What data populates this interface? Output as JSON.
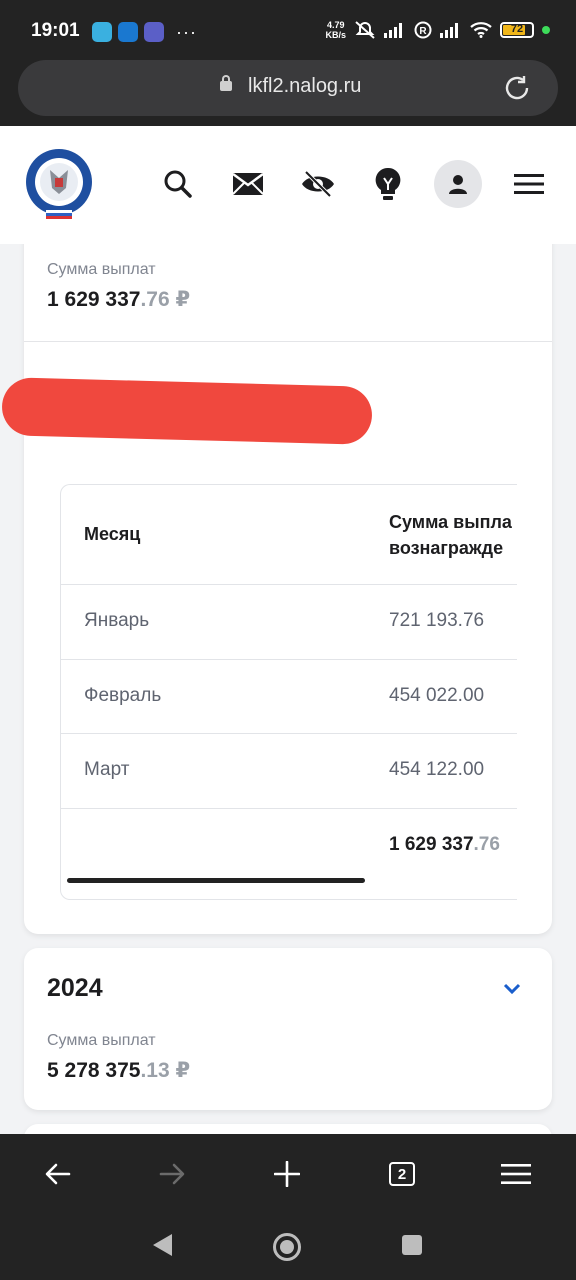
{
  "status_bar": {
    "time": "19:01",
    "more": "···",
    "speed_value": "4.79",
    "speed_unit": "KB/s",
    "battery": "72"
  },
  "browser": {
    "url": "lkfl2.nalog.ru",
    "tabs_count": "2"
  },
  "summary_top": {
    "label": "Сумма выплат",
    "amount_main": "1 629 337",
    "amount_kopecks": ".76 ₽"
  },
  "table": {
    "headers": [
      "Месяц",
      "Сумма выпла",
      "вознагражде"
    ],
    "rows": [
      {
        "month": "Январь",
        "amount": "721 193.76"
      },
      {
        "month": "Февраль",
        "amount": "454 022.00"
      },
      {
        "month": "Март",
        "amount": "454 122.00"
      }
    ],
    "total_main": "1 629 337",
    "total_kopecks": ".76"
  },
  "year_2024": {
    "year": "2024",
    "label": "Сумма выплат",
    "amount_main": "5 278 375",
    "amount_kopecks": ".13 ₽"
  },
  "icons": {
    "header": [
      "search-icon",
      "mail-icon",
      "hidden-eye-icon",
      "lightbulb-icon",
      "user-icon",
      "menu-icon"
    ],
    "toolbar": [
      "back-arrow-icon",
      "forward-arrow-icon",
      "plus-icon",
      "tabs-icon",
      "menu-icon"
    ],
    "nav": [
      "nav-back-icon",
      "nav-home-icon",
      "nav-recents-icon"
    ]
  },
  "colors": {
    "accent": "#1a5ecc",
    "redaction": "#f0483e",
    "dark_chrome": "#232323"
  }
}
